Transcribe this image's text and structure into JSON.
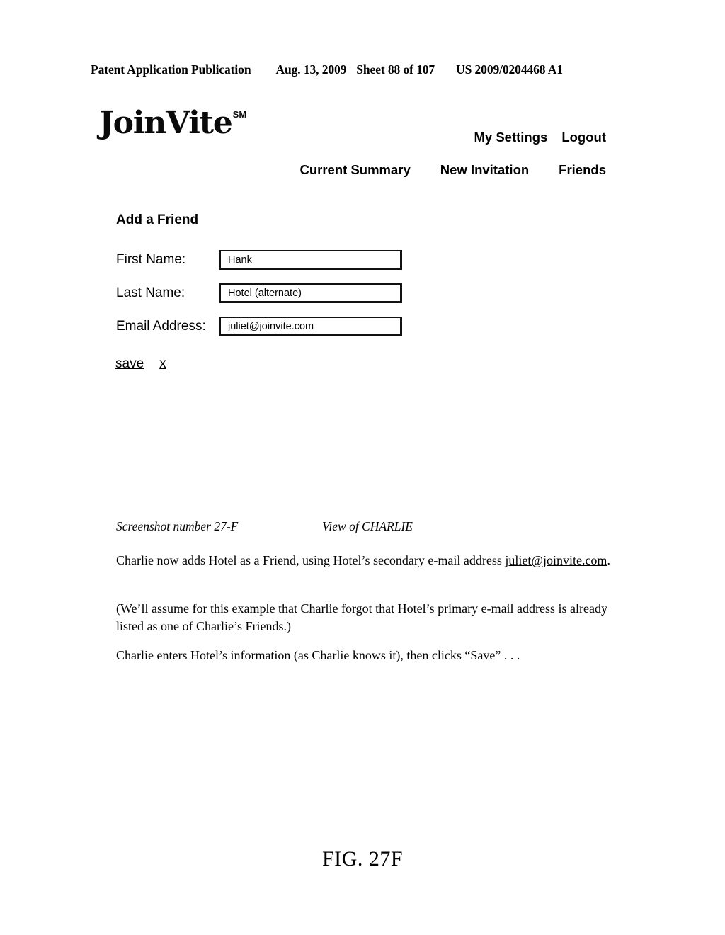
{
  "patent_header": {
    "publication": "Patent Application Publication",
    "date": "Aug. 13, 2009",
    "sheet": "Sheet 88 of 107",
    "number": "US 2009/0204468 A1"
  },
  "app": {
    "logo": {
      "name": "JoinVite",
      "mark": "SM"
    },
    "top_nav": [
      {
        "label": "My Settings"
      },
      {
        "label": "Logout"
      }
    ],
    "main_nav": [
      {
        "label": "Current Summary"
      },
      {
        "label": "New Invitation"
      },
      {
        "label": "Friends"
      }
    ],
    "form": {
      "title": "Add a Friend",
      "fields": [
        {
          "label": "First Name:",
          "value": "Hank"
        },
        {
          "label": "Last Name:",
          "value": "Hotel (alternate)"
        },
        {
          "label": "Email Address:",
          "value": "juliet@joinvite.com"
        }
      ],
      "actions": [
        {
          "label": "save"
        },
        {
          "label": "x"
        }
      ]
    }
  },
  "caption": {
    "screenshot_number": "Screenshot number 27-F",
    "view_of": "View of CHARLIE"
  },
  "description": {
    "para1_before": "Charlie now adds Hotel as a Friend, using Hotel’s secondary e-mail address ",
    "para1_link": "juliet@joinvite.com",
    "para1_after": ".",
    "para2": "(We’ll assume for this example that Charlie forgot that Hotel’s primary e-mail address is already listed as one of Charlie’s Friends.)",
    "para3": "Charlie enters Hotel’s information (as Charlie knows it), then clicks “Save” . . ."
  },
  "figure_label": "FIG. 27F"
}
